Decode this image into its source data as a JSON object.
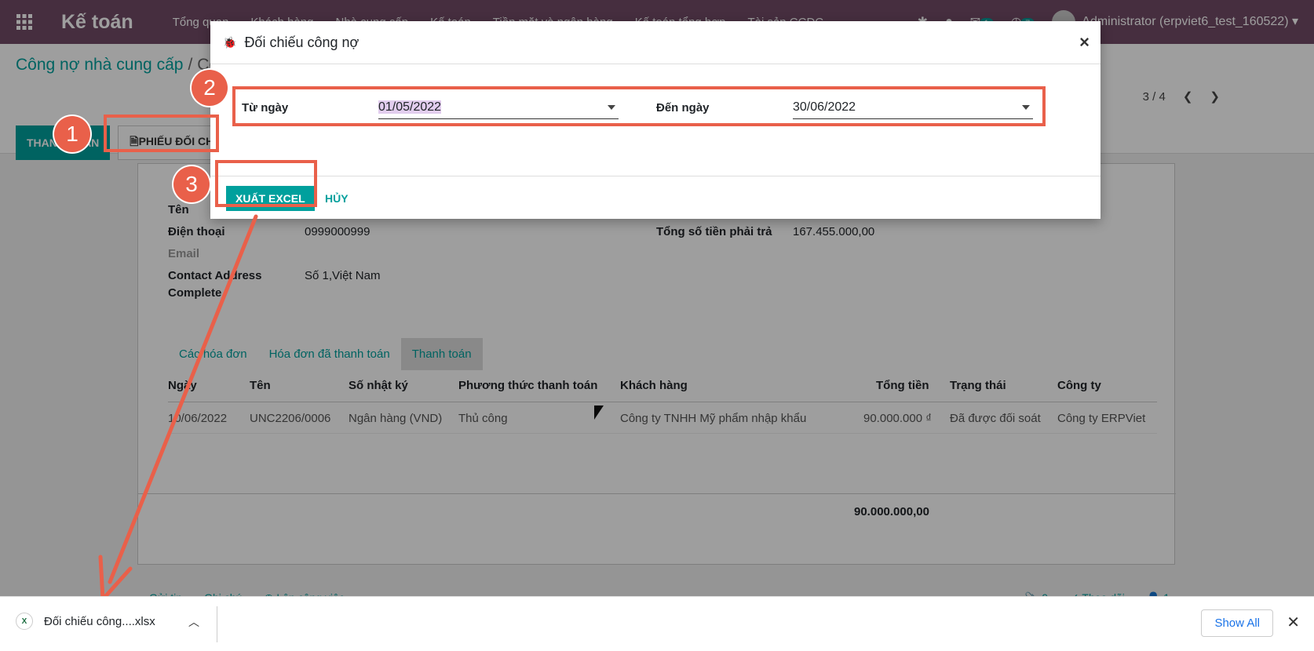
{
  "navbar": {
    "app_title": "Kế toán",
    "menu": [
      "Tổng quan",
      "Khách hàng",
      "Nhà cung cấp",
      "Kế toán",
      "Tiền mặt và ngân hàng",
      "Kế toán tổng hợp",
      "Tài sản CCDC"
    ],
    "messages_count": "1",
    "activities_count": "7",
    "user": "Administrator (erpviet6_test_160522)"
  },
  "control_panel": {
    "breadcrumb_parent": "Công nợ nhà cung cấp",
    "breadcrumb_current": "Cô",
    "pager": "3 / 4",
    "buttons": {
      "payment": "THANH TOÁN",
      "reconcile": "PHIẾU ĐỐI CH"
    }
  },
  "form": {
    "name_label": "Tên",
    "phone_label": "Điện thoại",
    "phone_value": "0999000999",
    "email_label": "Email",
    "address_label_1": "Contact Address",
    "address_label_2": "Complete",
    "address_value": "Số 1,Việt Nam",
    "total_label": "Tổng số tiền phải trả",
    "total_value": "167.455.000,00"
  },
  "tabs": [
    "Các hóa đơn",
    "Hóa đơn đã thanh toán",
    "Thanh toán"
  ],
  "table": {
    "headers": [
      "Ngày",
      "Tên",
      "Số nhật ký",
      "Phương thức thanh toán",
      "Khách hàng",
      "Tổng tiền",
      "Trạng thái",
      "Công ty"
    ],
    "rows": [
      [
        "10/06/2022",
        "UNC2206/0006",
        "Ngân hàng (VND)",
        "Thủ công",
        "Công ty TNHH Mỹ phẩm nhập khẩu",
        "90.000.000 ₫",
        "Đã được đối soát",
        "Công ty ERPViet"
      ]
    ],
    "total": "90.000.000,00"
  },
  "chatter": {
    "send": "Gửi tin",
    "note": "Ghi chú",
    "activity": "Lên công việc",
    "attachments": "0",
    "follow": "Theo dõi",
    "followers": "1"
  },
  "modal": {
    "title": "Đối chiếu công nợ",
    "from_label": "Từ ngày",
    "from_value": "01/05/2022",
    "to_label": "Đến ngày",
    "to_value": "30/06/2022",
    "export_label": "XUẤT EXCEL",
    "cancel_label": "HỦY",
    "close": "×"
  },
  "annotations": {
    "step1": "1",
    "step2": "2",
    "step3": "3",
    "color": "#E9604A"
  },
  "download_bar": {
    "file_name": "Đối chiếu công....xlsx",
    "show_all": "Show All",
    "close": "✕"
  }
}
